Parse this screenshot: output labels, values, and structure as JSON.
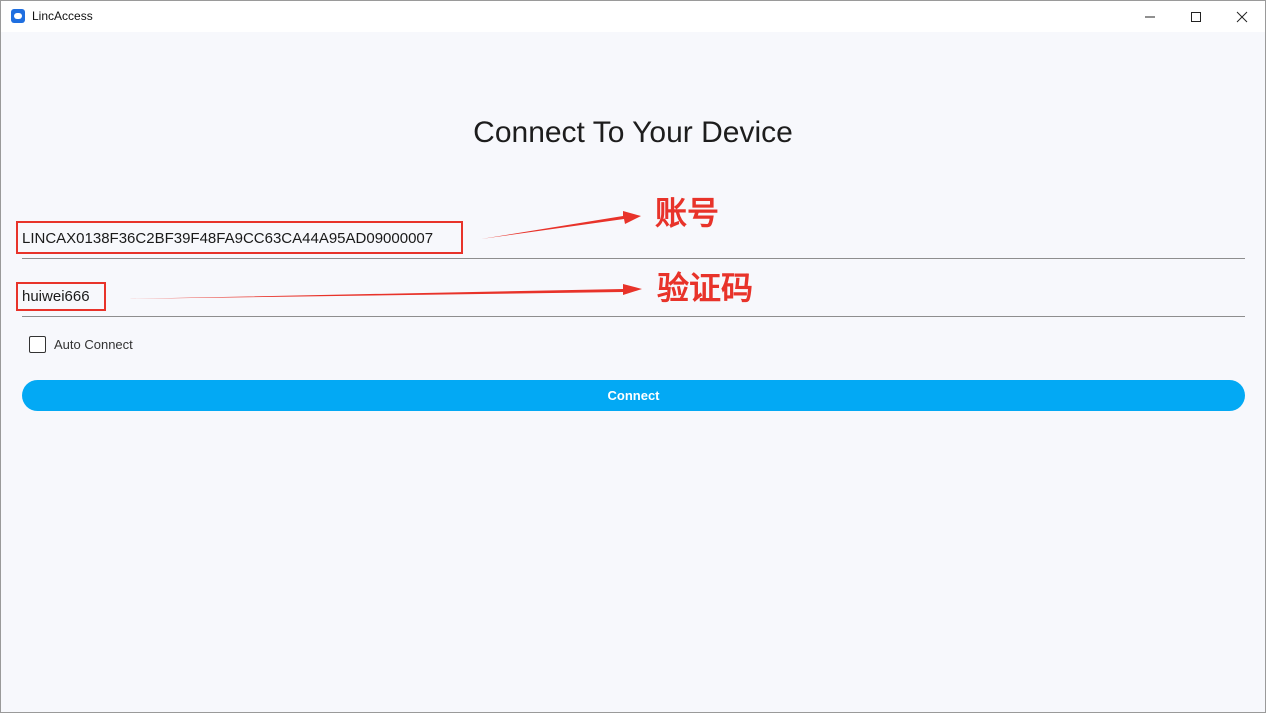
{
  "window": {
    "title": "LincAccess"
  },
  "main": {
    "heading": "Connect To Your Device",
    "account_value": "LINCAX0138F36C2BF39F48FA9CC63CA44A95AD09000007",
    "code_value": "huiwei666",
    "auto_connect_label": "Auto Connect",
    "auto_connect_checked": false,
    "connect_label": "Connect"
  },
  "annotations": {
    "account_label": "账号",
    "code_label": "验证码"
  },
  "colors": {
    "accent": "#03a9f4",
    "annotation": "#e8332a",
    "background": "#f7f8fc"
  },
  "icons": [
    "app-icon",
    "minimize-icon",
    "maximize-icon",
    "close-icon",
    "checkbox-icon",
    "arrow-icon"
  ]
}
